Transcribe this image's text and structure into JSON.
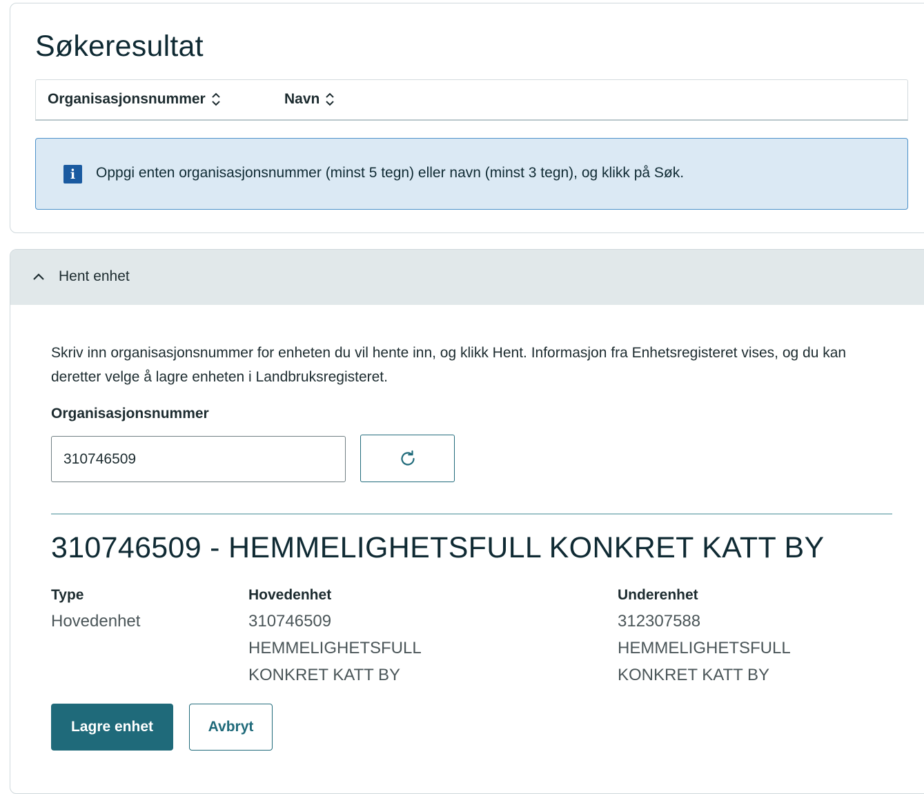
{
  "results": {
    "title": "Søkeresultat",
    "columns": [
      {
        "label": "Organisasjonsnummer",
        "icon": "sort-icon"
      },
      {
        "label": "Navn",
        "icon": "sort-icon"
      }
    ],
    "info": {
      "icon": "info-icon",
      "icon_glyph": "i",
      "text": "Oppgi enten organisasjonsnummer (minst 5 tegn) eller navn (minst 3 tegn), og klikk på Søk."
    }
  },
  "fetch": {
    "accordion_title": "Hent enhet",
    "accordion_icon": "chevron-up-icon",
    "description": "Skriv inn organisasjonsnummer for enheten du vil hente inn, og klikk Hent. Informasjon fra Enhetsregisteret vises, og du kan deretter velge å lagre enheten i Landbruksregisteret.",
    "field_label": "Organisasjonsnummer",
    "input_value": "310746509",
    "refresh_icon": "refresh-icon",
    "entity_title": "310746509 - HEMMELIGHETSFULL KONKRET KATT BY",
    "type": {
      "label": "Type",
      "lines": [
        "Hovedenhet"
      ]
    },
    "hovedenhet": {
      "label": "Hovedenhet",
      "lines": [
        "310746509",
        "HEMMELIGHETSFULL",
        "KONKRET KATT BY"
      ]
    },
    "underenhet": {
      "label": "Underenhet",
      "lines": [
        "312307588",
        "HEMMELIGHETSFULL",
        "KONKRET KATT BY"
      ]
    },
    "save_label": "Lagre enhet",
    "cancel_label": "Avbryt"
  },
  "colors": {
    "primary": "#1f6a7a",
    "info_bg": "#dbe9f4",
    "info_border": "#4a90c9",
    "accordion_bg": "#e1e8ea"
  }
}
